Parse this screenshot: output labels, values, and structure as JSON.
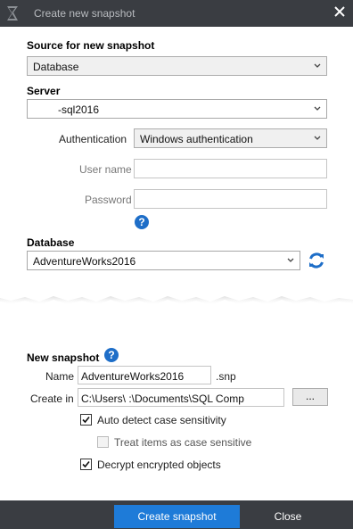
{
  "window": {
    "title": "Create new snapshot"
  },
  "source": {
    "heading": "Source for new snapshot",
    "selected": "Database"
  },
  "server": {
    "heading": "Server",
    "value": "-sql2016"
  },
  "auth": {
    "label": "Authentication",
    "selected": "Windows authentication",
    "username_label": "User name",
    "username_value": "",
    "password_label": "Password",
    "password_value": ""
  },
  "database": {
    "heading": "Database",
    "selected": "AdventureWorks2016"
  },
  "snapshot": {
    "heading": "New snapshot",
    "name_label": "Name",
    "name_value": "AdventureWorks2016",
    "ext": ".snp",
    "create_in_label": "Create in",
    "create_in_value": "C:\\Users\\                    :\\Documents\\SQL Comp",
    "browse_label": "..."
  },
  "options": {
    "auto_detect": {
      "label": "Auto detect case sensitivity",
      "checked": true
    },
    "case_sensitive": {
      "label": "Treat items as case sensitive",
      "checked": false
    },
    "decrypt": {
      "label": "Decrypt encrypted objects",
      "checked": true
    }
  },
  "footer": {
    "primary_label": "Create snapshot",
    "close_label": "Close"
  },
  "colors": {
    "titlebar": "#3a3d42",
    "accent": "#1e7bd8",
    "help": "#1e6ec8"
  }
}
